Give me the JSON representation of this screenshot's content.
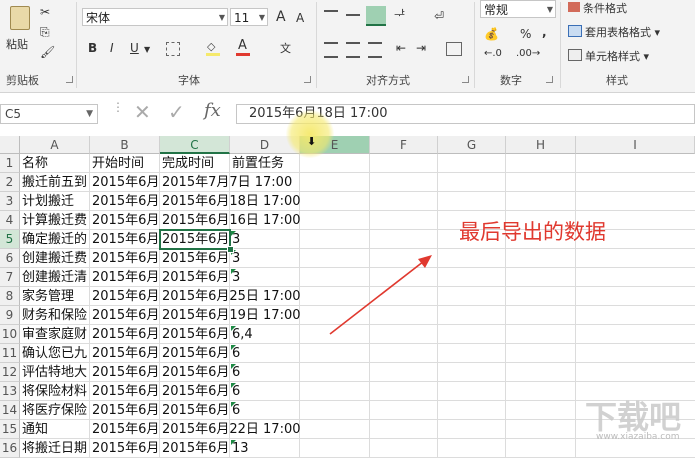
{
  "ribbon": {
    "paste_label": "粘贴",
    "clipboard_label": "剪贴板",
    "font_name": "宋体",
    "font_size": "11",
    "grow_font": "A",
    "shrink_font": "A",
    "bold": "B",
    "italic": "I",
    "underline": "U",
    "wen": "文",
    "font_label": "字体",
    "align_label": "对齐方式",
    "number_format": "常规",
    "percent": "%",
    "comma": ",",
    "number_label": "数字",
    "cond_format": "条件格式",
    "table_format": "套用表格格式",
    "cell_style": "单元格样式",
    "styles_label": "样式"
  },
  "formula_bar": {
    "name_box": "C5",
    "fx": "fx",
    "content": "2015年6月18日  17:00"
  },
  "columns": [
    "A",
    "B",
    "C",
    "D",
    "E",
    "F",
    "G",
    "H",
    "I"
  ],
  "rows": [
    {
      "n": "1",
      "a": "名称",
      "b": "开始时间",
      "c": "完成时间",
      "d": "前置任务"
    },
    {
      "n": "2",
      "a": "搬迁前五到",
      "b": "2015年6月",
      "c": "2015年7月7日 17:00",
      "d": ""
    },
    {
      "n": "3",
      "a": "计划搬迁",
      "b": "2015年6月",
      "c": "2015年6月18日 17:00",
      "d": ""
    },
    {
      "n": "4",
      "a": "计算搬迁费",
      "b": "2015年6月",
      "c": "2015年6月16日 17:00",
      "d": ""
    },
    {
      "n": "5",
      "a": "确定搬迁的",
      "b": "2015年6月",
      "c": "2015年6月",
      "d": "3"
    },
    {
      "n": "6",
      "a": "创建搬迁费",
      "b": "2015年6月",
      "c": "2015年6月",
      "d": "3"
    },
    {
      "n": "7",
      "a": "创建搬迁清",
      "b": "2015年6月",
      "c": "2015年6月",
      "d": "3"
    },
    {
      "n": "8",
      "a": "家务管理",
      "b": "2015年6月",
      "c": "2015年6月25日 17:00",
      "d": ""
    },
    {
      "n": "9",
      "a": "财务和保险",
      "b": "2015年6月",
      "c": "2015年6月19日 17:00",
      "d": ""
    },
    {
      "n": "10",
      "a": "审查家庭财",
      "b": "2015年6月",
      "c": "2015年6月",
      "d": "6,4"
    },
    {
      "n": "11",
      "a": "确认您已九",
      "b": "2015年6月",
      "c": "2015年6月",
      "d": "6"
    },
    {
      "n": "12",
      "a": "评估特地大",
      "b": "2015年6月",
      "c": "2015年6月",
      "d": "6"
    },
    {
      "n": "13",
      "a": "将保险材料",
      "b": "2015年6月",
      "c": "2015年6月",
      "d": "6"
    },
    {
      "n": "14",
      "a": "将医疗保险",
      "b": "2015年6月",
      "c": "2015年6月",
      "d": "6"
    },
    {
      "n": "15",
      "a": "通知",
      "b": "2015年6月",
      "c": "2015年6月22日 17:00",
      "d": ""
    },
    {
      "n": "16",
      "a": "将搬迁日期",
      "b": "2015年6月",
      "c": "2015年6月",
      "d": "13"
    }
  ],
  "annotation": "最后导出的数据",
  "watermark": "下载吧",
  "watermark_url": "www.xiazaiba.com",
  "colors": {
    "accent": "#217346",
    "annotation": "#e0392f",
    "highlight": "#f5e96b"
  }
}
